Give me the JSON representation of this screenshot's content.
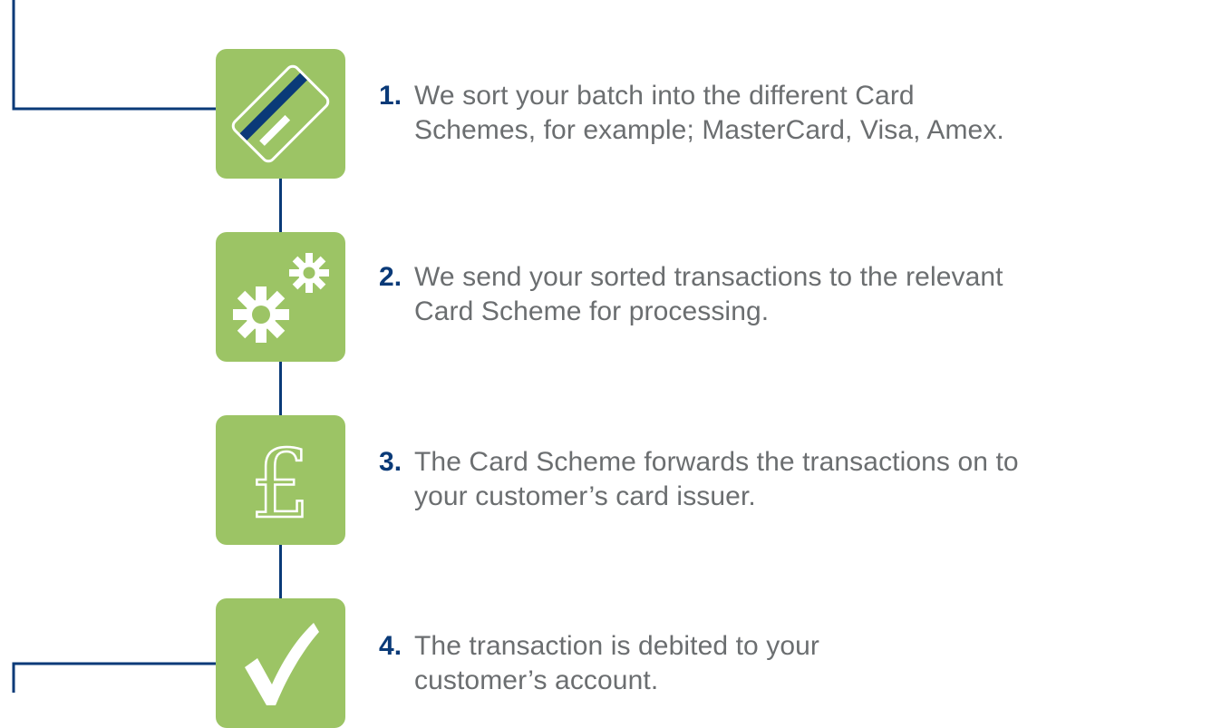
{
  "colors": {
    "accent_green": "#9cc465",
    "connector_blue": "#0a3a78",
    "number_blue": "#0a3a78",
    "text_grey": "#6b6e70",
    "icon_white": "#ffffff"
  },
  "steps": [
    {
      "number": "1.",
      "icon": "credit-card-icon",
      "lines": [
        "We sort your batch into the different Card",
        "Schemes, for example; MasterCard, Visa, Amex."
      ]
    },
    {
      "number": "2.",
      "icon": "gears-icon",
      "lines": [
        "We send your sorted transactions to the relevant",
        "Card Scheme for processing."
      ]
    },
    {
      "number": "3.",
      "icon": "pound-icon",
      "lines": [
        "The Card Scheme forwards the transactions on to",
        "your customer’s card issuer."
      ]
    },
    {
      "number": "4.",
      "icon": "checkmark-icon",
      "lines": [
        "The transaction is debited to your",
        "customer’s account."
      ]
    }
  ]
}
